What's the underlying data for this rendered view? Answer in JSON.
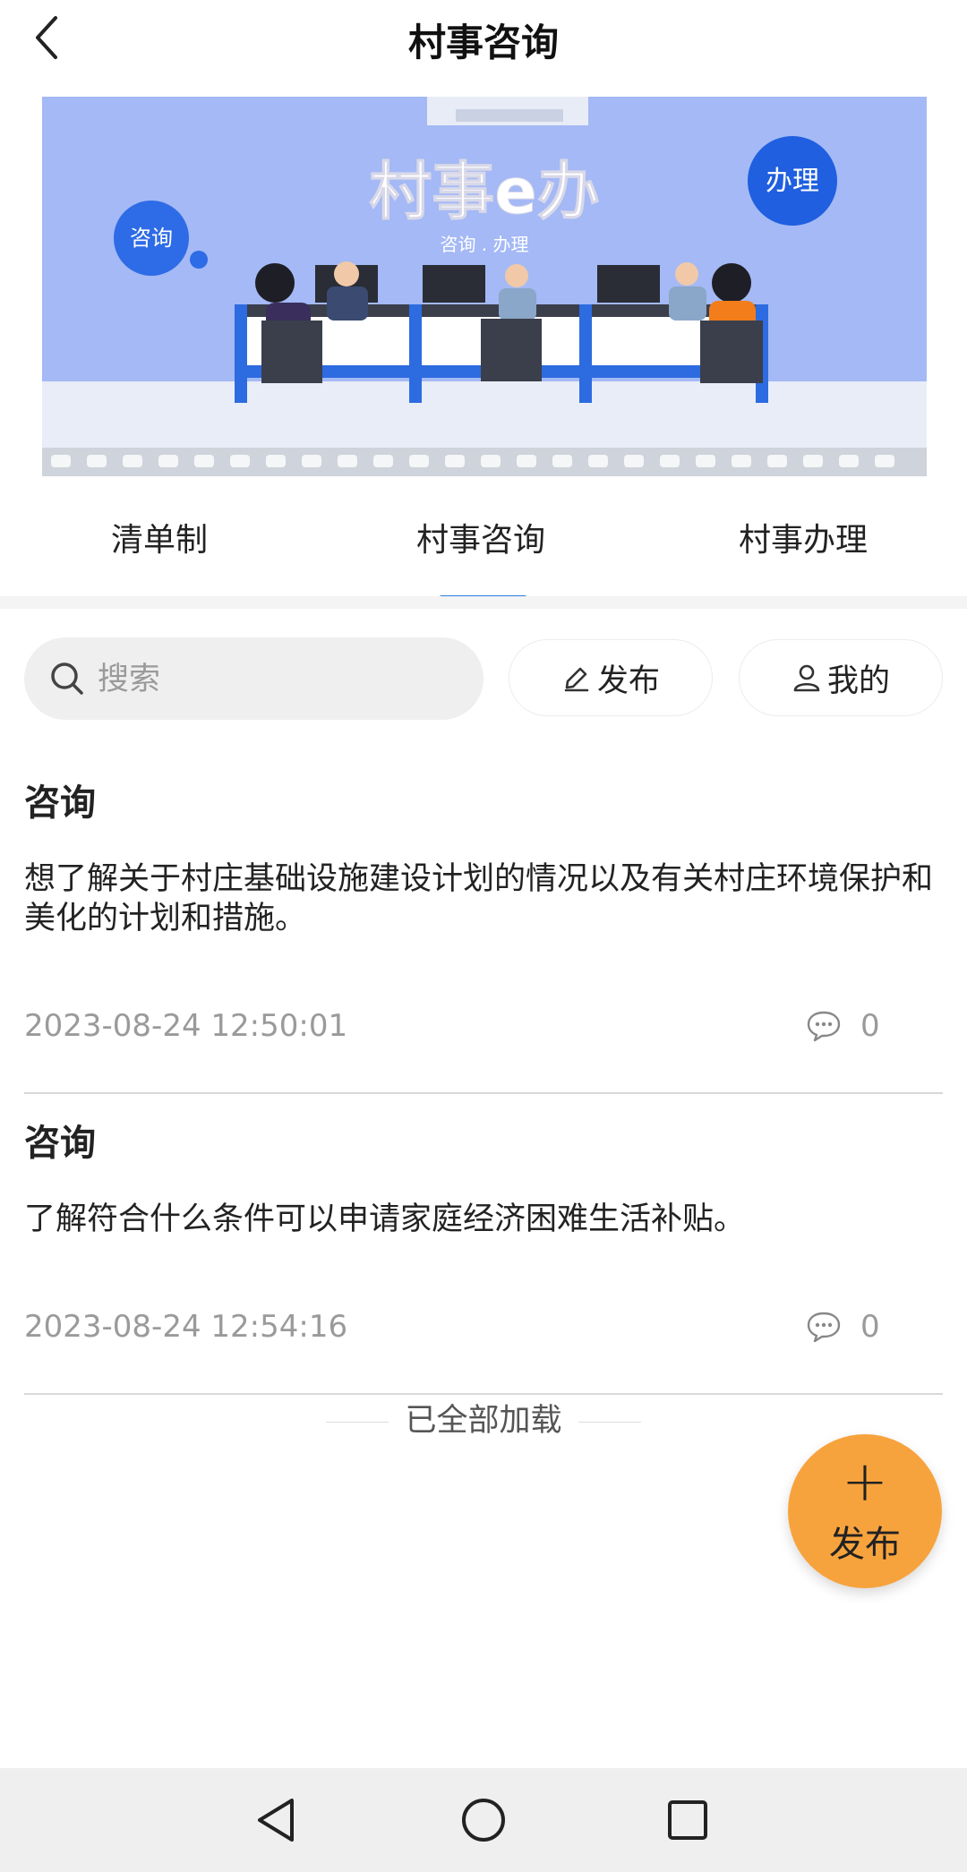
{
  "header": {
    "title": "村事咨询"
  },
  "banner": {
    "heading": "村事e办",
    "subheading": "咨询 . 办理",
    "left_bubble": "咨询",
    "right_bubble": "办理"
  },
  "tabs": [
    {
      "label": "清单制",
      "active": false
    },
    {
      "label": "村事咨询",
      "active": true
    },
    {
      "label": "村事办理",
      "active": false
    }
  ],
  "toolbar": {
    "search_placeholder": "搜索",
    "publish_label": "发布",
    "mine_label": "我的"
  },
  "posts": [
    {
      "title": "咨询",
      "body": "想了解关于村庄基础设施建设计划的情况以及有关村庄环境保护和美化的计划和措施。",
      "time": "2023-08-24 12:50:01",
      "comments": "0"
    },
    {
      "title": "咨询",
      "body": "了解符合什么条件可以申请家庭经济困难生活补贴。",
      "time": "2023-08-24 12:54:16",
      "comments": "0"
    }
  ],
  "footer_text": "已全部加载",
  "fab": {
    "icon": "plus-icon",
    "label": "发布"
  },
  "colors": {
    "accent": "#2b7de0",
    "fab": "#f7a33d",
    "banner_bg": "#a4b9f5",
    "bubble": "#2e6be6"
  }
}
